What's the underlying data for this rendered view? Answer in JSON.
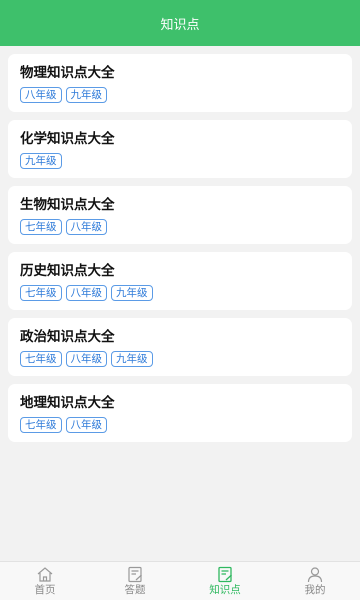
{
  "header": {
    "title": "知识点"
  },
  "subjects": [
    {
      "title": "物理知识点大全",
      "grades": [
        "八年级",
        "九年级"
      ]
    },
    {
      "title": "化学知识点大全",
      "grades": [
        "九年级"
      ]
    },
    {
      "title": "生物知识点大全",
      "grades": [
        "七年级",
        "八年级"
      ]
    },
    {
      "title": "历史知识点大全",
      "grades": [
        "七年级",
        "八年级",
        "九年级"
      ]
    },
    {
      "title": "政治知识点大全",
      "grades": [
        "七年级",
        "八年级",
        "九年级"
      ]
    },
    {
      "title": "地理知识点大全",
      "grades": [
        "七年级",
        "八年级"
      ]
    }
  ],
  "tabbar": {
    "tabs": [
      {
        "label": "首页",
        "icon": "home-icon",
        "active": false
      },
      {
        "label": "答题",
        "icon": "quiz-icon",
        "active": false
      },
      {
        "label": "知识点",
        "icon": "knowledge-icon",
        "active": true
      },
      {
        "label": "我的",
        "icon": "profile-icon",
        "active": false
      }
    ]
  },
  "colors": {
    "accent": "#3ec06b",
    "tag": "#2f7bd9",
    "active_tab": "#2fb85f"
  }
}
